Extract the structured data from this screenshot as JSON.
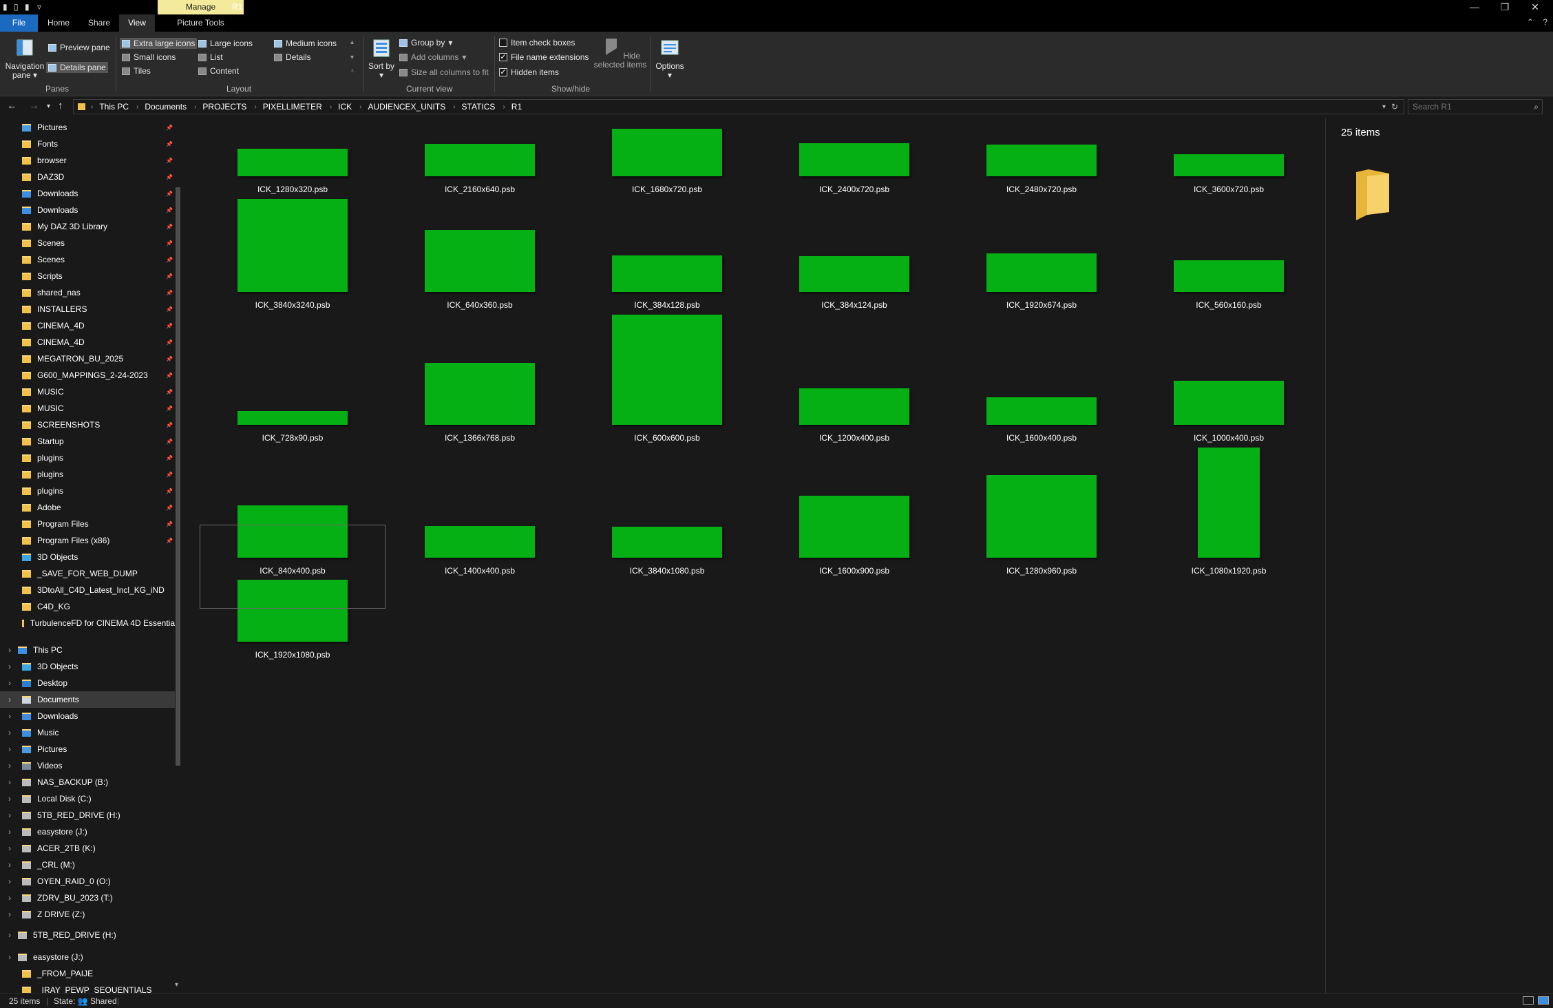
{
  "titlebar": {
    "manage_label": "Manage",
    "window_title": "R1",
    "minimize": "—",
    "restore": "❐",
    "close": "✕"
  },
  "tabs": {
    "file": "File",
    "home": "Home",
    "share": "Share",
    "view": "View",
    "picture_tools": "Picture Tools"
  },
  "ribbon": {
    "panes": {
      "group": "Panes",
      "navigation_pane": "Navigation pane",
      "preview_pane": "Preview pane",
      "details_pane": "Details pane"
    },
    "layout": {
      "group": "Layout",
      "extra_large": "Extra large icons",
      "large": "Large icons",
      "medium": "Medium icons",
      "small": "Small icons",
      "list": "List",
      "details": "Details",
      "tiles": "Tiles",
      "content": "Content"
    },
    "current_view": {
      "group": "Current view",
      "sort_by": "Sort by",
      "group_by": "Group by",
      "add_columns": "Add columns",
      "size_columns": "Size all columns to fit"
    },
    "show_hide": {
      "group": "Show/hide",
      "item_check_boxes": "Item check boxes",
      "file_name_extensions": "File name extensions",
      "hidden_items": "Hidden items",
      "hide_selected": "Hide selected items"
    },
    "options": "Options"
  },
  "address": {
    "crumbs": [
      "This PC",
      "Documents",
      "PROJECTS",
      "PIXELLIMETER",
      "ICK",
      "AUDIENCEX_UNITS",
      "STATICS",
      "R1"
    ],
    "search_placeholder": "Search R1"
  },
  "nav": {
    "quick_access": [
      "Pictures",
      "Fonts",
      "browser",
      "DAZ3D",
      "Downloads",
      "Downloads",
      "My DAZ 3D Library",
      "Scenes",
      "Scenes",
      "Scripts",
      "shared_nas",
      "INSTALLERS",
      "CINEMA_4D",
      "CINEMA_4D",
      "MEGATRON_BU_2025",
      "G600_MAPPINGS_2-24-2023",
      "MUSIC",
      "MUSIC",
      "SCREENSHOTS",
      "Startup",
      "plugins",
      "plugins",
      "plugins",
      "Adobe",
      "Program Files",
      "Program Files (x86)",
      "3D Objects",
      "_SAVE_FOR_WEB_DUMP",
      "3DtoAll_C4D_Latest_Incl_KG_iND",
      "C4D_KG",
      "TurbulenceFD for CINEMA 4D Essentia"
    ],
    "this_pc": "This PC",
    "this_pc_items": [
      "3D Objects",
      "Desktop",
      "Documents",
      "Downloads",
      "Music",
      "Pictures",
      "Videos",
      "NAS_BACKUP (B:)",
      "Local Disk (C:)",
      "5TB_RED_DRIVE (H:)",
      "easystore (J:)",
      "ACER_2TB (K:)",
      "_CRL (M:)",
      "OYEN_RAID_0 (O:)",
      "ZDRV_BU_2023 (T:)",
      "Z DRIVE (Z:)"
    ],
    "red_drive": "5TB_RED_DRIVE (H:)",
    "easystore": "easystore (J:)",
    "easystore_items": [
      "_FROM_PAIJE",
      "_IRAY_PEWP_SEQUENTIALS"
    ]
  },
  "files": [
    {
      "name": "ICK_1280x320.psb",
      "w": 1280,
      "h": 320
    },
    {
      "name": "ICK_2160x640.psb",
      "w": 2160,
      "h": 640
    },
    {
      "name": "ICK_1680x720.psb",
      "w": 1680,
      "h": 720
    },
    {
      "name": "ICK_2400x720.psb",
      "w": 2400,
      "h": 720
    },
    {
      "name": "ICK_2480x720.psb",
      "w": 2480,
      "h": 720
    },
    {
      "name": "ICK_3600x720.psb",
      "w": 3600,
      "h": 720
    },
    {
      "name": "ICK_3840x3240.psb",
      "w": 3840,
      "h": 3240
    },
    {
      "name": "ICK_640x360.psb",
      "w": 640,
      "h": 360
    },
    {
      "name": "ICK_384x128.psb",
      "w": 384,
      "h": 128
    },
    {
      "name": "ICK_384x124.psb",
      "w": 384,
      "h": 124
    },
    {
      "name": "ICK_1920x674.psb",
      "w": 1920,
      "h": 674
    },
    {
      "name": "ICK_560x160.psb",
      "w": 560,
      "h": 160
    },
    {
      "name": "ICK_728x90.psb",
      "w": 728,
      "h": 90
    },
    {
      "name": "ICK_1366x768.psb",
      "w": 1366,
      "h": 768
    },
    {
      "name": "ICK_600x600.psb",
      "w": 600,
      "h": 600
    },
    {
      "name": "ICK_1200x400.psb",
      "w": 1200,
      "h": 400
    },
    {
      "name": "ICK_1600x400.psb",
      "w": 1600,
      "h": 400
    },
    {
      "name": "ICK_1000x400.psb",
      "w": 1000,
      "h": 400
    },
    {
      "name": "ICK_840x400.psb",
      "w": 840,
      "h": 400
    },
    {
      "name": "ICK_1400x400.psb",
      "w": 1400,
      "h": 400
    },
    {
      "name": "ICK_3840x1080.psb",
      "w": 3840,
      "h": 1080
    },
    {
      "name": "ICK_1600x900.psb",
      "w": 1600,
      "h": 900
    },
    {
      "name": "ICK_1280x960.psb",
      "w": 1280,
      "h": 960
    },
    {
      "name": "ICK_1080x1920.psb",
      "w": 1080,
      "h": 1920
    },
    {
      "name": "ICK_1920x1080.psb",
      "w": 1920,
      "h": 1080
    }
  ],
  "details_pane": {
    "count": "25 items"
  },
  "status": {
    "count": "25 items",
    "state": "State: 👥 Shared"
  },
  "colors": {
    "thumbnail": "#05b015",
    "folder": "#f0c24a",
    "file_tab": "#1b6ac0",
    "manage_tab": "#f4ea9b"
  }
}
